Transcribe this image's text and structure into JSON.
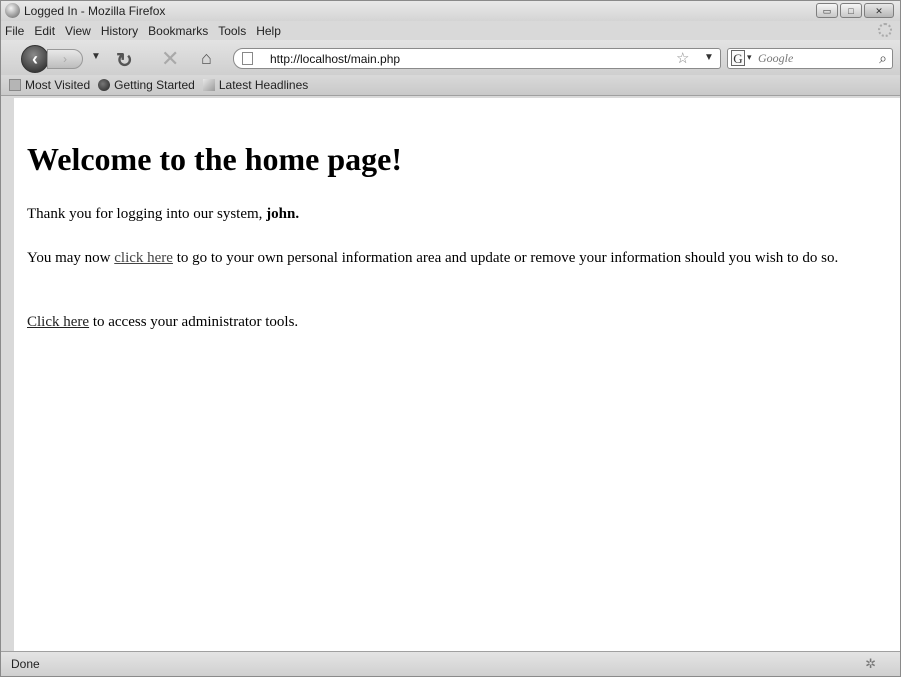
{
  "window": {
    "title": "Logged In - Mozilla Firefox",
    "buttons": {
      "minimize": "▭",
      "maximize": "□",
      "close": "✕"
    }
  },
  "menubar": {
    "items": [
      "File",
      "Edit",
      "View",
      "History",
      "Bookmarks",
      "Tools",
      "Help"
    ]
  },
  "navbar": {
    "url": "http://localhost/main.php",
    "search_placeholder": "Google",
    "icons": {
      "back": "back-arrow-icon",
      "forward": "forward-arrow-icon",
      "reload": "reload-icon",
      "stop": "stop-icon",
      "home": "home-icon",
      "bookmark_star": "star-icon",
      "search_engine": "google-icon",
      "search_go": "magnifier-icon"
    }
  },
  "bookmarks": {
    "items": [
      "Most Visited",
      "Getting Started",
      "Latest Headlines"
    ]
  },
  "page": {
    "heading": "Welcome to the home page!",
    "p1_prefix": "Thank you for logging into our system, ",
    "p1_user": "john.",
    "p2_prefix": "You may now ",
    "p2_link": "click here",
    "p2_suffix": " to go to your own personal information area and update or remove your information should you wish to do so.",
    "p3_link": "Click here",
    "p3_suffix": " to access your administrator tools."
  },
  "status": {
    "text": "Done"
  }
}
